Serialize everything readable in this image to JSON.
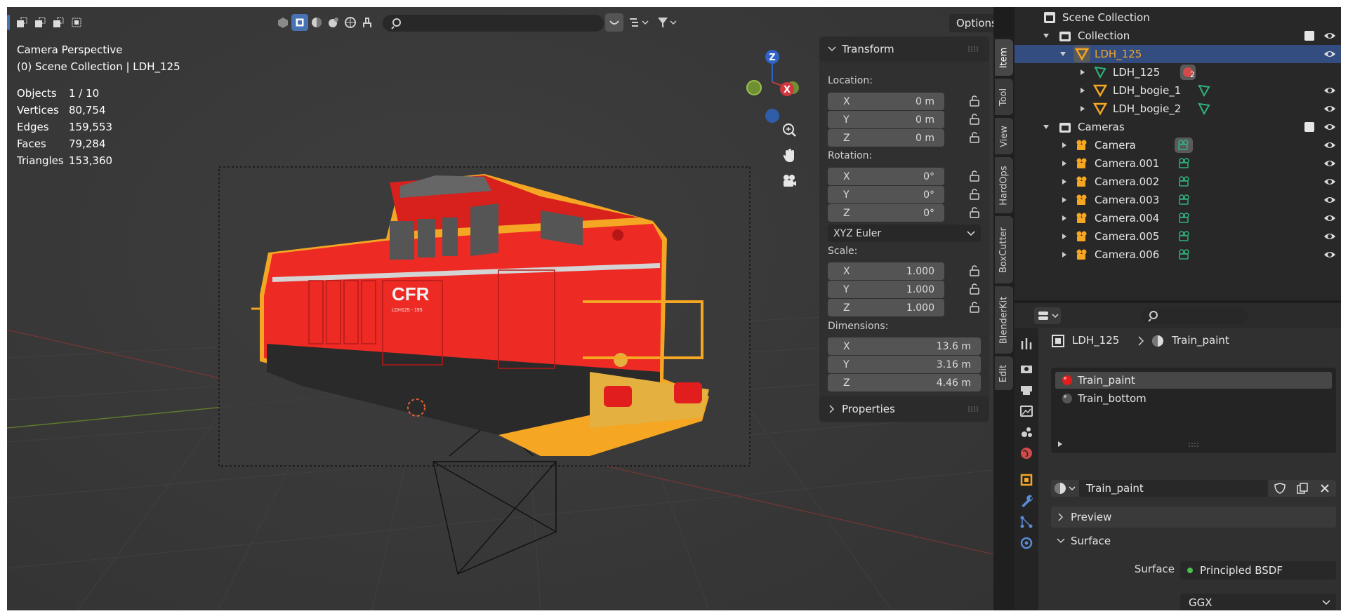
{
  "viewport": {
    "options_label": "Options",
    "view_name": "Camera Perspective",
    "context": "(0) Scene Collection | LDH_125",
    "stats": [
      {
        "label": "Objects",
        "value": "1 / 10"
      },
      {
        "label": "Vertices",
        "value": "80,754"
      },
      {
        "label": "Edges",
        "value": "159,553"
      },
      {
        "label": "Faces",
        "value": "79,284"
      },
      {
        "label": "Triangles",
        "value": "153,360"
      }
    ],
    "gizmo": {
      "z": "Z",
      "x": "X"
    },
    "model": {
      "logo": "CFR",
      "subtext": "LDH125 - 195"
    }
  },
  "npanel": {
    "transform_title": "Transform",
    "location_label": "Location:",
    "location": [
      {
        "axis": "X",
        "value": "0 m"
      },
      {
        "axis": "Y",
        "value": "0 m"
      },
      {
        "axis": "Z",
        "value": "0 m"
      }
    ],
    "rotation_label": "Rotation:",
    "rotation": [
      {
        "axis": "X",
        "value": "0°"
      },
      {
        "axis": "Y",
        "value": "0°"
      },
      {
        "axis": "Z",
        "value": "0°"
      }
    ],
    "rotation_mode": "XYZ Euler",
    "scale_label": "Scale:",
    "scale": [
      {
        "axis": "X",
        "value": "1.000"
      },
      {
        "axis": "Y",
        "value": "1.000"
      },
      {
        "axis": "Z",
        "value": "1.000"
      }
    ],
    "dimensions_label": "Dimensions:",
    "dimensions": [
      {
        "axis": "X",
        "value": "13.6 m"
      },
      {
        "axis": "Y",
        "value": "3.16 m"
      },
      {
        "axis": "Z",
        "value": "4.46 m"
      }
    ],
    "properties_title": "Properties"
  },
  "vtabs": [
    "Item",
    "Tool",
    "View",
    "HardOps",
    "BoxCutter",
    "BlenderKit",
    "Edit"
  ],
  "outliner": {
    "rows": [
      {
        "label": "Scene Collection"
      },
      {
        "label": "Collection"
      },
      {
        "label": "LDH_125"
      },
      {
        "label": "LDH_125",
        "badge": "2"
      },
      {
        "label": "LDH_bogie_1"
      },
      {
        "label": "LDH_bogie_2"
      },
      {
        "label": "Cameras"
      },
      {
        "label": "Camera"
      },
      {
        "label": "Camera.001"
      },
      {
        "label": "Camera.002"
      },
      {
        "label": "Camera.003"
      },
      {
        "label": "Camera.004"
      },
      {
        "label": "Camera.005"
      },
      {
        "label": "Camera.006"
      }
    ]
  },
  "properties": {
    "breadcrumb_object": "LDH_125",
    "breadcrumb_material": "Train_paint",
    "materials": [
      "Train_paint",
      "Train_bottom"
    ],
    "material_name": "Train_paint",
    "preview_label": "Preview",
    "surface_section": "Surface",
    "surface_label": "Surface",
    "surface_shader": "Principled BSDF",
    "distribution": "GGX"
  },
  "colors": {
    "accent": "#4772b3",
    "selection": "#334d80",
    "object_orange": "#f5a623",
    "camera_green": "#2fb37e",
    "model_red": "#ee2a24"
  }
}
